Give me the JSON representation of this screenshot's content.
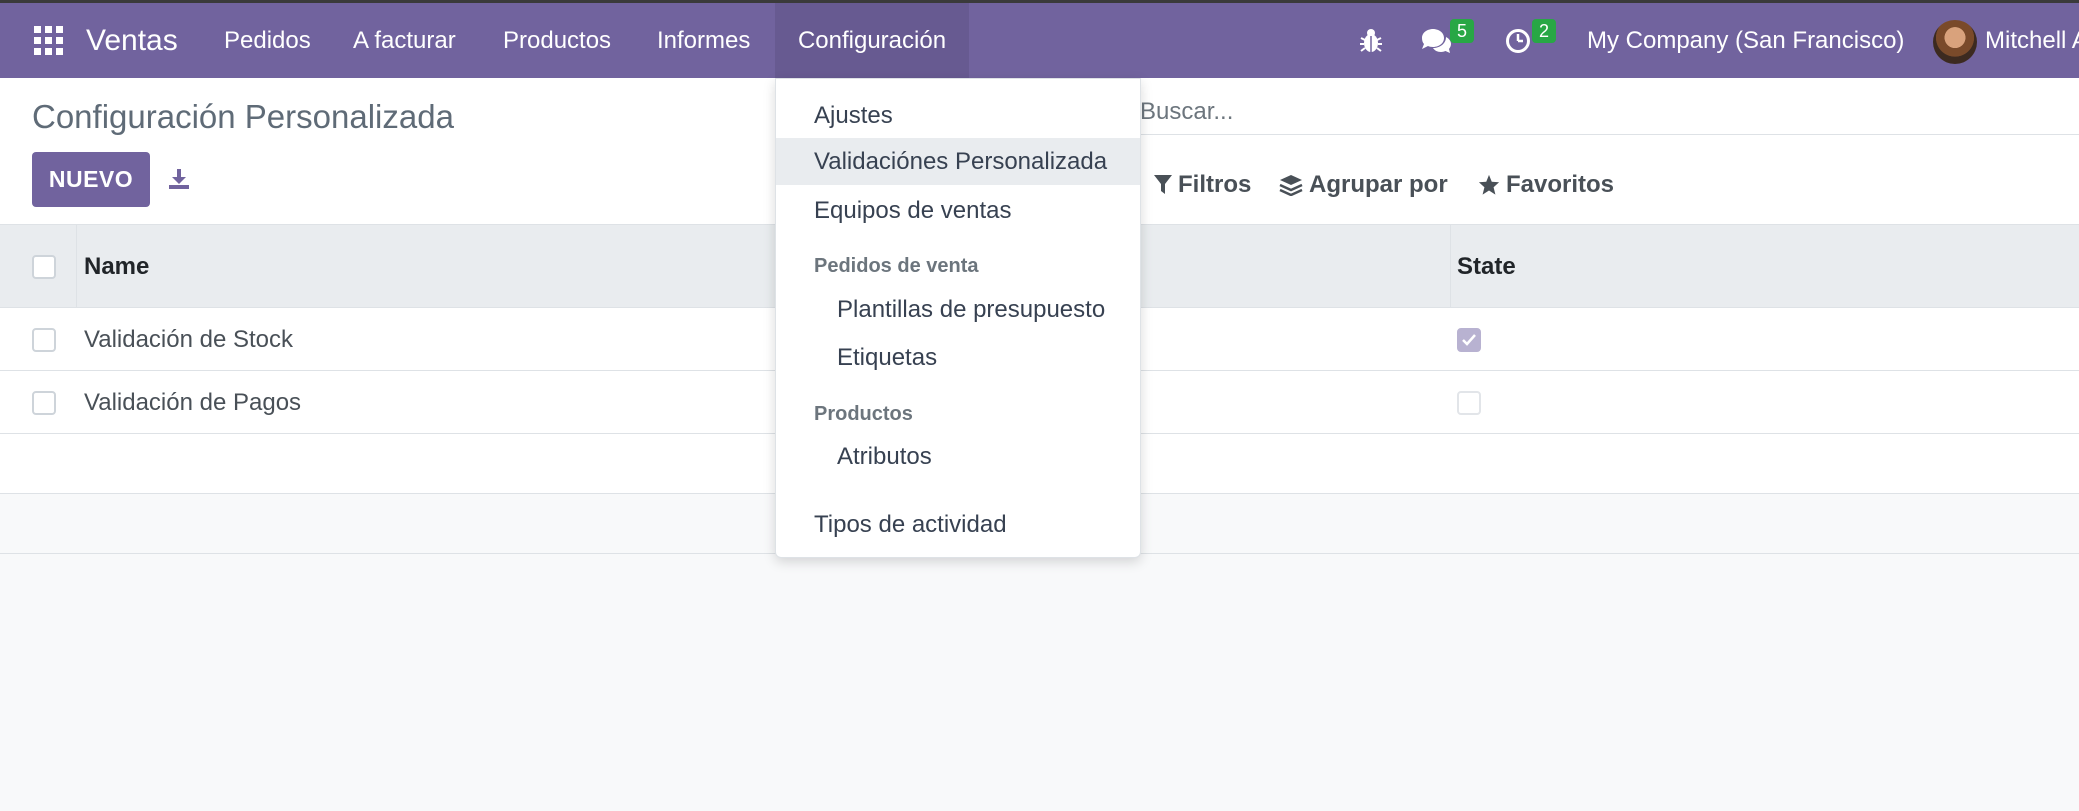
{
  "navbar": {
    "brand": "Ventas",
    "menus": [
      "Pedidos",
      "A facturar",
      "Productos",
      "Informes",
      "Configuración"
    ],
    "messages_count": "5",
    "activities_count": "2",
    "company": "My Company (San Francisco)",
    "user": "Mitchell Admin"
  },
  "control_panel": {
    "title": "Configuración Personalizada",
    "new_button": "NUEVO",
    "search_placeholder": "Buscar...",
    "filters_label": "Filtros",
    "groupby_label": "Agrupar por",
    "favorites_label": "Favoritos"
  },
  "table": {
    "headers": {
      "name": "Name",
      "state": "State"
    },
    "rows": [
      {
        "name": "Validación de Stock",
        "state": true
      },
      {
        "name": "Validación de Pagos",
        "state": false
      }
    ]
  },
  "dropdown": {
    "items": {
      "ajustes": "Ajustes",
      "validaciones": "Validaciónes Personalizada",
      "equipos": "Equipos de ventas",
      "header_pedidos": "Pedidos de venta",
      "plantillas": "Plantillas de presupuesto",
      "etiquetas": "Etiquetas",
      "header_productos": "Productos",
      "atributos": "Atributos",
      "tipos": "Tipos de actividad"
    }
  },
  "colors": {
    "brand": "#71639e",
    "badge": "#28a745"
  }
}
